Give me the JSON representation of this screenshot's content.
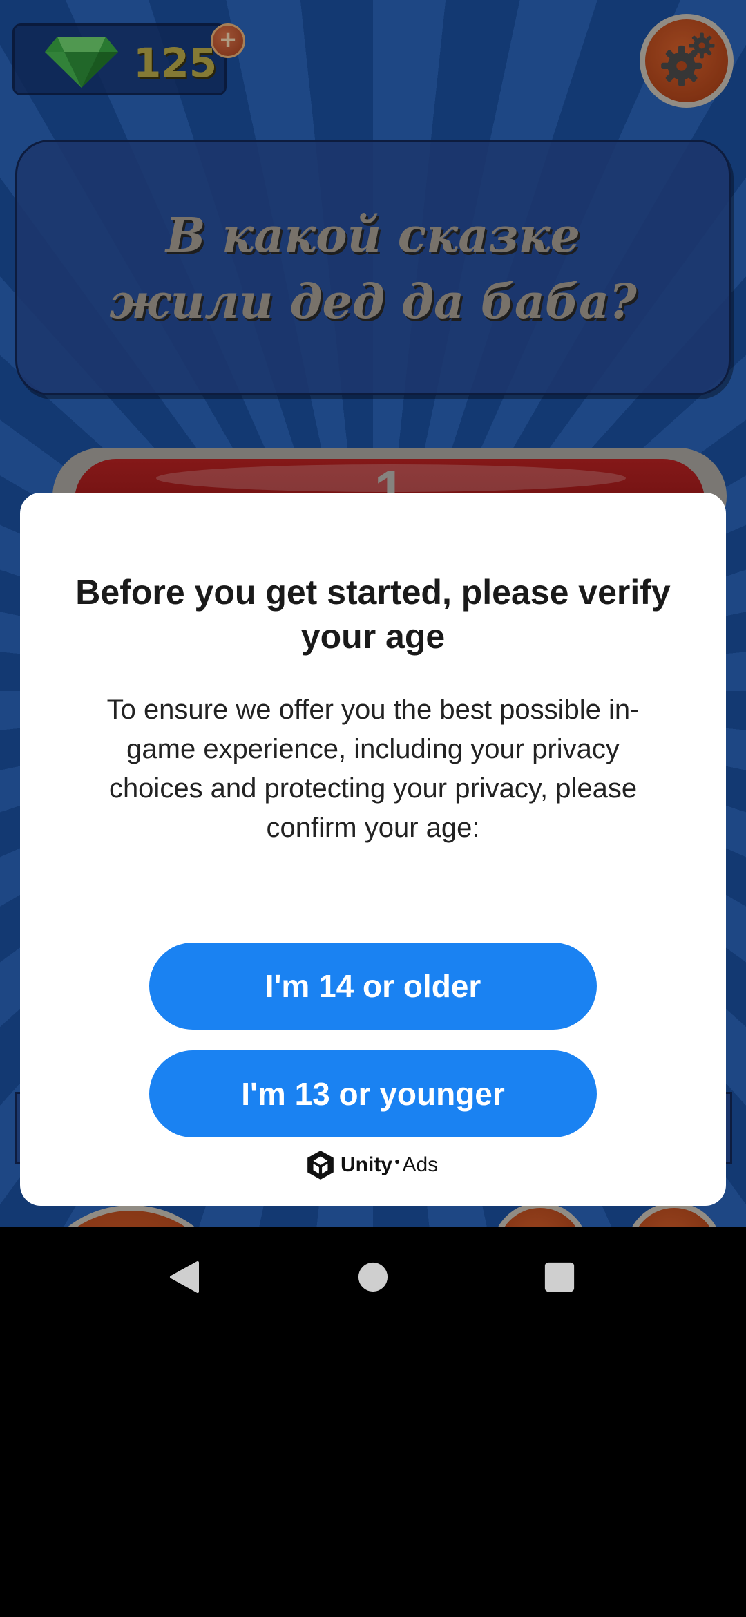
{
  "game": {
    "gem_count": "125",
    "question": "В какой сказке жили дед да баба?",
    "answer_number": "1"
  },
  "dialog": {
    "title": "Before you get started, please verify your age",
    "body": "To ensure we offer you the best possible in-game experience, including your privacy choices and protecting your privacy, please confirm your age:",
    "button_older": "I'm 14 or older",
    "button_younger": "I'm 13 or younger",
    "brand_name": "Unity",
    "brand_suffix": "Ads"
  },
  "nav": {
    "icons": [
      "back-icon",
      "home-icon",
      "recents-icon"
    ]
  },
  "colors": {
    "accent": "#1a82f2",
    "dialog_bg": "#ffffff",
    "game_bg": "#2a63b8"
  }
}
